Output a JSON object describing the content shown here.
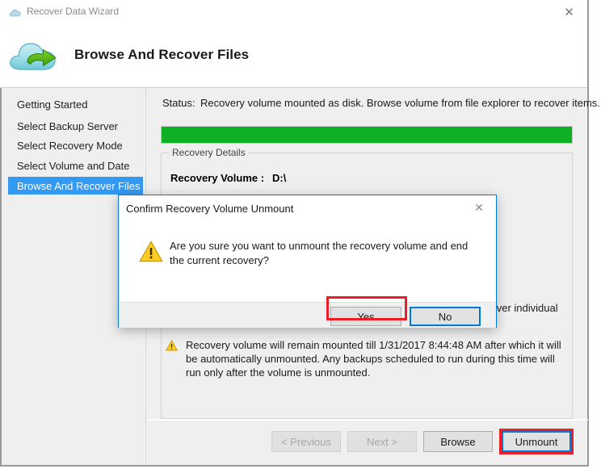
{
  "window": {
    "title": "Recover Data Wizard",
    "title_icon": "cloud-icon",
    "close_label": "✕"
  },
  "header": {
    "title": "Browse And Recover Files",
    "logo_icon": "cloud-recovery-logo"
  },
  "sidebar": {
    "items": [
      {
        "label": "Getting Started",
        "selected": false
      },
      {
        "label": "Select Backup Server",
        "selected": false
      },
      {
        "label": "Select Recovery Mode",
        "selected": false
      },
      {
        "label": "Select Volume and Date",
        "selected": false
      },
      {
        "label": "Browse And Recover Files",
        "selected": true
      }
    ],
    "selected_color": "#3399f3"
  },
  "main": {
    "status_label": "Status:",
    "status_value": "Recovery volume mounted as disk. Browse volume from file explorer to recover items.",
    "progress": {
      "percent": 100,
      "color": "#0db123"
    },
    "details": {
      "legend": "Recovery Details",
      "volume_label": "Recovery Volume :",
      "volume_value": "D:\\",
      "occluded_text": "cover individual"
    },
    "note": {
      "icon": "warning-triangle-icon",
      "text": "Recovery volume will remain mounted till 1/31/2017 8:44:48 AM after which it will be automatically unmounted. Any backups scheduled to run during this time will run only after the volume is unmounted."
    }
  },
  "footer": {
    "previous_label": "< Previous",
    "next_label": "Next >",
    "browse_label": "Browse",
    "unmount_label": "Unmount"
  },
  "dialog": {
    "title": "Confirm Recovery Volume Unmount",
    "close_label": "✕",
    "icon": "warning-triangle-icon",
    "message": "Are you sure you want to unmount the recovery volume and end the current recovery?",
    "yes_label": "Yes",
    "no_label": "No"
  },
  "annotations": {
    "highlight_color": "#ee1c25",
    "focus_color": "#0078d7"
  }
}
